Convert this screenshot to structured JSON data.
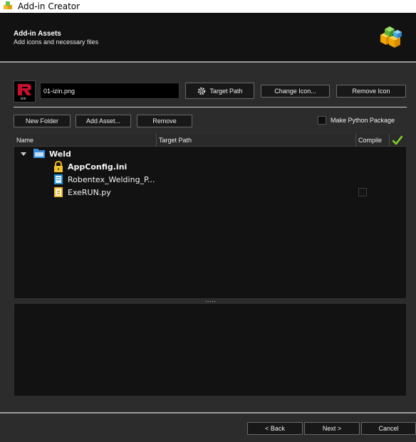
{
  "window": {
    "title": "Add-in Creator"
  },
  "header": {
    "title": "Add-in Assets",
    "subtitle": "Add icons and necessary files"
  },
  "icon_panel": {
    "icon_caption": "izin",
    "filename": "01-izin.png"
  },
  "toolbar1": {
    "target_path": "Target Path",
    "change_icon": "Change Icon...",
    "remove_icon": "Remove Icon"
  },
  "toolbar2": {
    "new_folder": "New Folder",
    "add_asset": "Add Asset...",
    "remove": "Remove",
    "make_python_label": "Make Python Package",
    "make_python_checked": false
  },
  "tree": {
    "columns": {
      "name": "Name",
      "target_path": "Target Path",
      "compile": "Compile"
    },
    "root": {
      "label": "Weld",
      "expanded": true
    },
    "items": [
      {
        "label": "AppConfig.ini",
        "icon": "lock-icon"
      },
      {
        "label": "Robentex_Welding_P...",
        "icon": "file-icon"
      },
      {
        "label": "ExeRUN.py",
        "icon": "python-file-icon",
        "compile": false
      }
    ]
  },
  "footer": {
    "back": "< Back",
    "next": "Next >",
    "cancel": "Cancel"
  },
  "colors": {
    "background": "#2c2c2c",
    "header": "#121212",
    "panel": "#121212",
    "accent_green": "#7fd22a",
    "brand_red": "#c8102e"
  }
}
